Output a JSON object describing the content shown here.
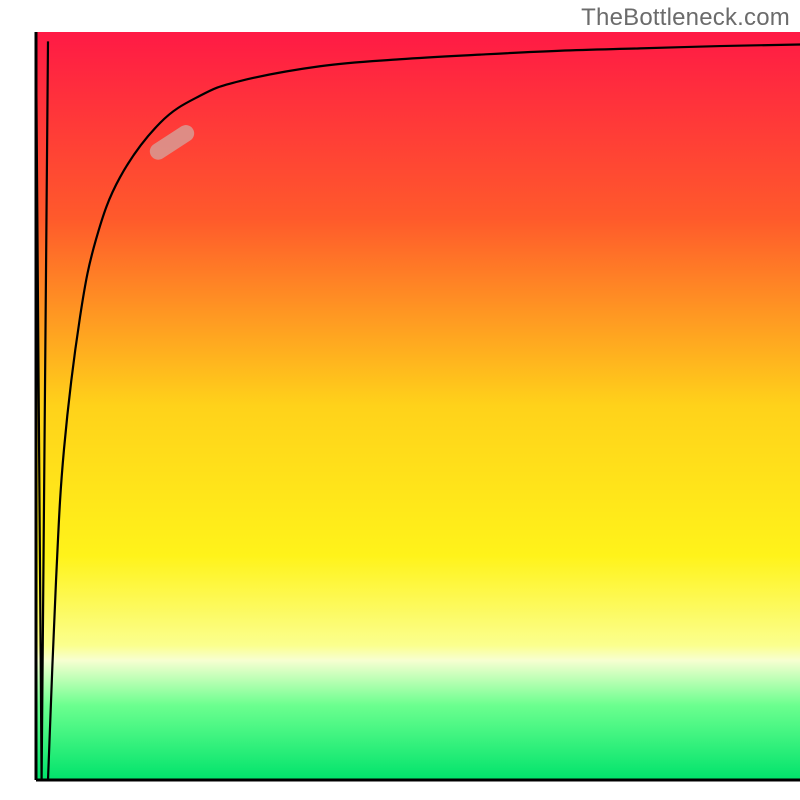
{
  "watermark": "TheBottleneck.com",
  "chart_data": {
    "type": "line",
    "title": "",
    "xlabel": "",
    "ylabel": "",
    "xlim": [
      0,
      100
    ],
    "ylim": [
      0,
      100
    ],
    "grid": false,
    "legend": false,
    "background_gradient_stops": [
      {
        "pos": 0.0,
        "color": "#ff1a45"
      },
      {
        "pos": 0.25,
        "color": "#ff5a2b"
      },
      {
        "pos": 0.5,
        "color": "#ffd21a"
      },
      {
        "pos": 0.7,
        "color": "#fff31a"
      },
      {
        "pos": 0.82,
        "color": "#fbff8e"
      },
      {
        "pos": 0.84,
        "color": "#f7ffd1"
      },
      {
        "pos": 0.9,
        "color": "#6cff8f"
      },
      {
        "pos": 1.0,
        "color": "#00e36b"
      }
    ],
    "series": [
      {
        "name": "spike",
        "x": [
          4.5,
          5.2,
          6.0
        ],
        "y": [
          97.5,
          2.4,
          97.5
        ]
      },
      {
        "name": "curve",
        "x": [
          6.0,
          7.0,
          8.0,
          10.0,
          12.0,
          15.0,
          20.0,
          25.0,
          30.0,
          40.0,
          50.0,
          60.0,
          70.0,
          80.0,
          90.0,
          100.0
        ],
        "y": [
          2.4,
          28.0,
          45.0,
          62.0,
          72.0,
          80.0,
          87.0,
          90.5,
          92.4,
          94.3,
          95.2,
          95.8,
          96.3,
          96.6,
          96.9,
          97.1
        ]
      }
    ],
    "marker": {
      "x": 21.5,
      "y": 84.5,
      "angle_deg": -33,
      "length": 6.5,
      "width": 2.2,
      "color": "#d89a93",
      "opacity": 0.85
    },
    "axis": {
      "left_x": 4.5,
      "bottom_y": 2.4,
      "stroke": "#000000",
      "stroke_width": 3
    },
    "curve_stroke": "#000000",
    "curve_stroke_width": 2.2
  }
}
